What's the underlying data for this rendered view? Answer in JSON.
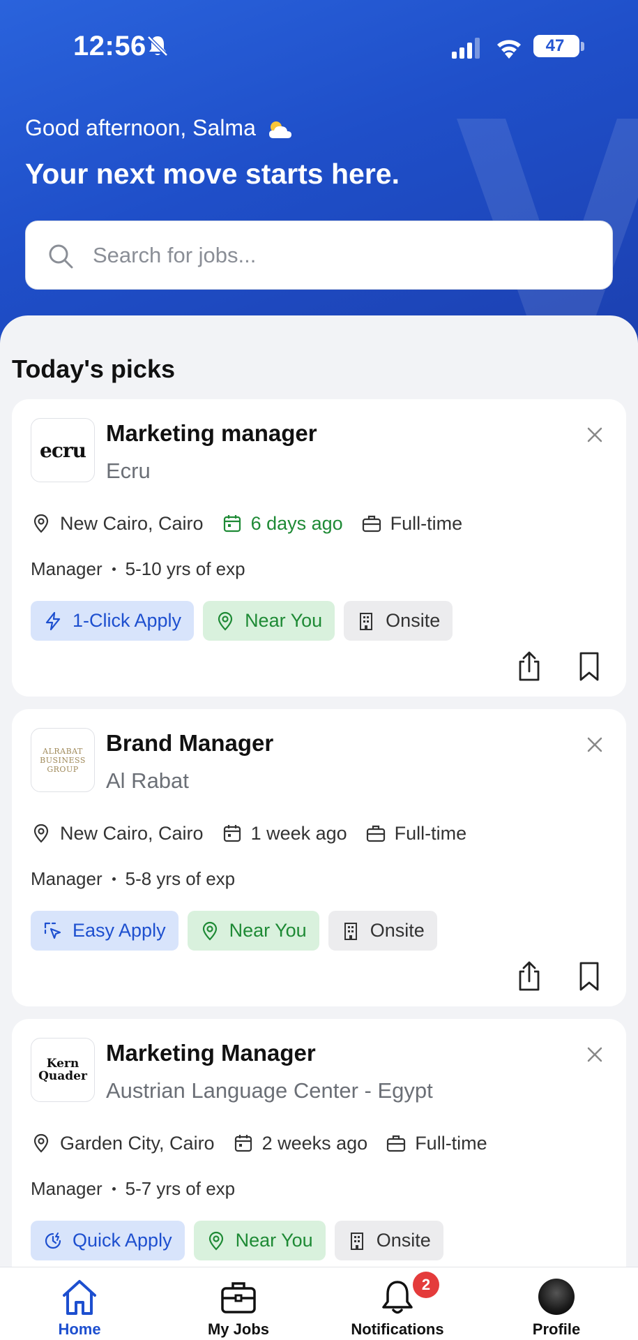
{
  "status_bar": {
    "time": "12:56",
    "battery": "47"
  },
  "header": {
    "greeting": "Good afternoon, Salma",
    "headline": "Your next move starts here."
  },
  "search": {
    "placeholder": "Search for jobs..."
  },
  "section_title": "Today's picks",
  "jobs": [
    {
      "title": "Marketing manager",
      "company": "Ecru",
      "logo_text": "ecru",
      "location": "New Cairo, Cairo",
      "posted": "6 days ago",
      "posted_highlight": true,
      "type": "Full-time",
      "level": "Manager",
      "experience": "5-10 yrs of exp",
      "tags": [
        "1-Click Apply",
        "Near You",
        "Onsite"
      ]
    },
    {
      "title": "Brand Manager",
      "company": "Al Rabat",
      "logo_text": "ALRABAT BUSINESS GROUP",
      "location": "New Cairo, Cairo",
      "posted": "1 week ago",
      "posted_highlight": false,
      "type": "Full-time",
      "level": "Manager",
      "experience": "5-8 yrs of exp",
      "tags": [
        "Easy Apply",
        "Near You",
        "Onsite"
      ]
    },
    {
      "title": "Marketing Manager",
      "company": "Austrian Language Center - Egypt",
      "logo_text": "Kern Quader",
      "location": "Garden City, Cairo",
      "posted": "2 weeks ago",
      "posted_highlight": false,
      "type": "Full-time",
      "level": "Manager",
      "experience": "5-7 yrs of exp",
      "tags": [
        "Quick Apply",
        "Near You",
        "Onsite"
      ]
    }
  ],
  "bottom_nav": {
    "items": [
      "Home",
      "My Jobs",
      "Notifications",
      "Profile"
    ],
    "notifications_badge": "2"
  },
  "colors": {
    "brand": "#2456d2",
    "accent_green": "#1e8a35",
    "badge_red": "#e43b3b"
  }
}
